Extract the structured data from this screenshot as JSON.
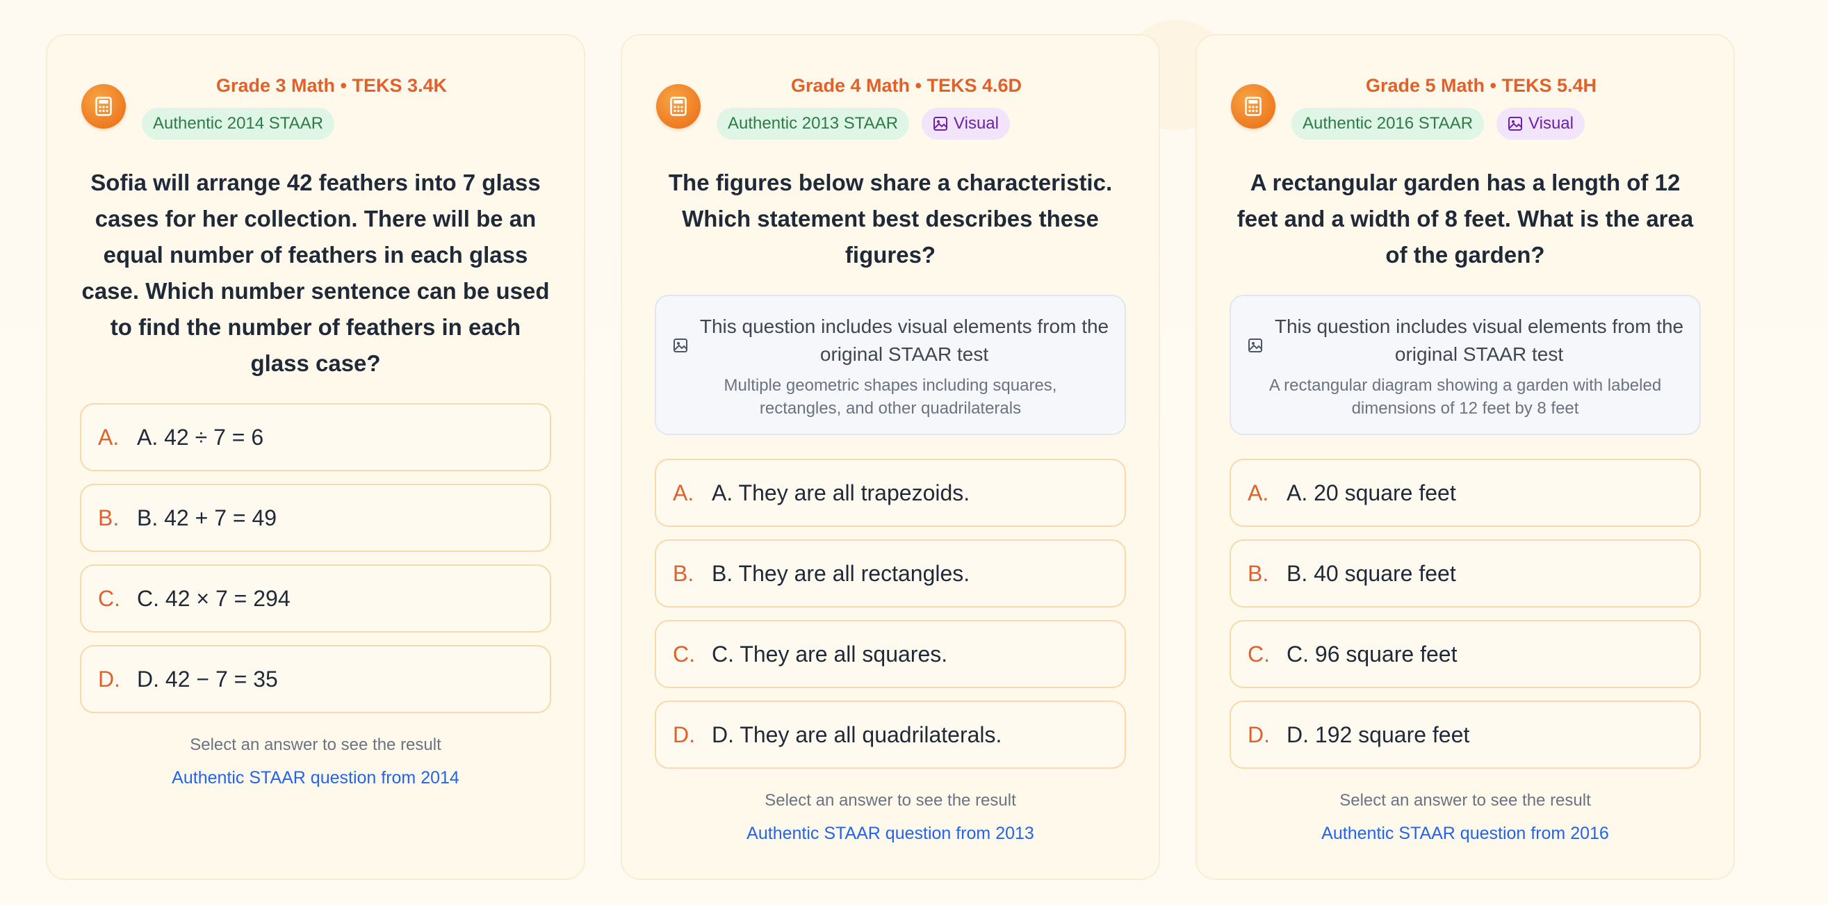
{
  "cards": [
    {
      "title": "Grade 3 Math • TEKS 3.4K",
      "badge": "Authentic 2014 STAAR",
      "question": "Sofia will arrange 42 feathers into 7 glass cases for her collection. There will be an equal number of feathers in each glass case. Which number sentence can be used to find the number of feathers in each glass case?",
      "options": [
        {
          "letter": "A.",
          "text": "A. 42 ÷ 7 = 6"
        },
        {
          "letter": "B.",
          "text": "B. 42 + 7 = 49"
        },
        {
          "letter": "C.",
          "text": "C. 42 × 7 = 294"
        },
        {
          "letter": "D.",
          "text": "D. 42 − 7 = 35"
        }
      ],
      "hint": "Select an answer to see the result",
      "source": "Authentic STAAR question from 2014"
    },
    {
      "title": "Grade 4 Math • TEKS 4.6D",
      "badge": "Authentic 2013 STAAR",
      "visual_badge": "Visual",
      "question": "The figures below share a characteristic. Which statement best describes these figures?",
      "visual_note": "This question includes visual elements from the original STAAR test",
      "visual_desc": "Multiple geometric shapes including squares, rectangles, and other quadrilaterals",
      "options": [
        {
          "letter": "A.",
          "text": "A. They are all trapezoids."
        },
        {
          "letter": "B.",
          "text": "B. They are all rectangles."
        },
        {
          "letter": "C.",
          "text": "C. They are all squares."
        },
        {
          "letter": "D.",
          "text": "D. They are all quadrilaterals."
        }
      ],
      "hint": "Select an answer to see the result",
      "source": "Authentic STAAR question from 2013"
    },
    {
      "title": "Grade 5 Math • TEKS 5.4H",
      "badge": "Authentic 2016 STAAR",
      "visual_badge": "Visual",
      "question": "A rectangular garden has a length of 12 feet and a width of 8 feet. What is the area of the garden?",
      "visual_note": "This question includes visual elements from the original STAAR test",
      "visual_desc": "A rectangular diagram showing a garden with labeled dimensions of 12 feet by 8 feet",
      "options": [
        {
          "letter": "A.",
          "text": "A. 20 square feet"
        },
        {
          "letter": "B.",
          "text": "B. 40 square feet"
        },
        {
          "letter": "C.",
          "text": "C. 96 square feet"
        },
        {
          "letter": "D.",
          "text": "D. 192 square feet"
        }
      ],
      "hint": "Select an answer to see the result",
      "source": "Authentic STAAR question from 2016"
    }
  ],
  "icons": {
    "card_icon": "calculator-icon",
    "visual_icon": "image-icon"
  },
  "colors": {
    "accent": "#e0612a",
    "link": "#2563eb",
    "badge_green": "#2f7a48",
    "badge_purple": "#6b21a8"
  }
}
